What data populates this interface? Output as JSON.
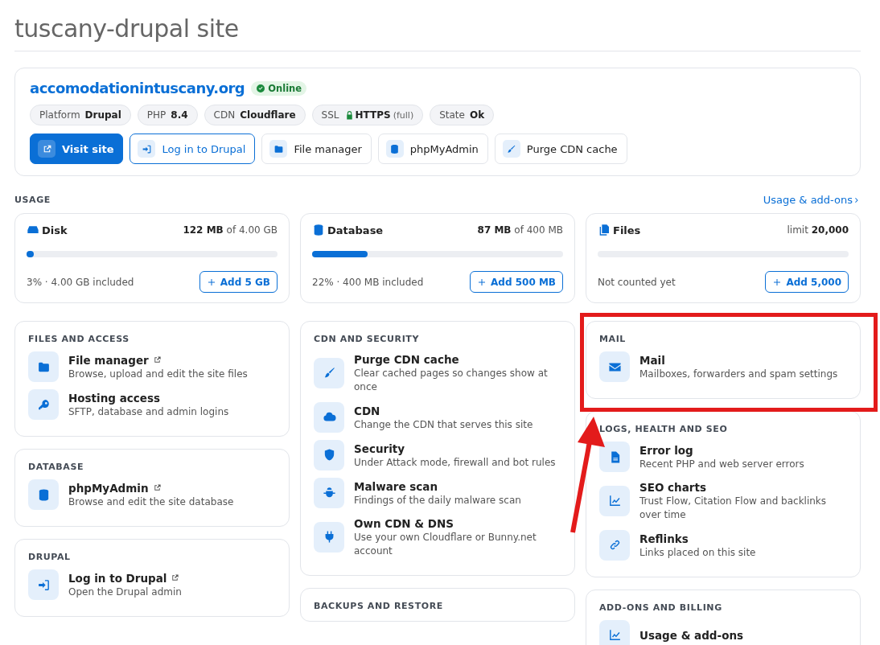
{
  "page_title": "tuscany-drupal site",
  "site": {
    "domain": "accomodationintuscany.org",
    "status": "Online",
    "facts": [
      {
        "label": "Platform",
        "value": "Drupal",
        "kind": "plain"
      },
      {
        "label": "PHP",
        "value": "8.4",
        "kind": "plain"
      },
      {
        "label": "CDN",
        "value": "Cloudflare",
        "kind": "plain"
      },
      {
        "label": "SSL",
        "value": "HTTPS",
        "note": "(full)",
        "kind": "secure"
      },
      {
        "label": "State",
        "value": "Ok",
        "kind": "plain"
      }
    ],
    "actions": [
      {
        "label": "Visit site",
        "kind": "primary"
      },
      {
        "label": "Log in to Drupal",
        "kind": "outline"
      },
      {
        "label": "File manager",
        "kind": "plain"
      },
      {
        "label": "phpMyAdmin",
        "kind": "plain"
      },
      {
        "label": "Purge CDN cache",
        "kind": "plain"
      }
    ]
  },
  "usage": {
    "heading": "USAGE",
    "link": "Usage & add-ons",
    "meters": [
      {
        "title": "Disk",
        "reading": "**122 MB** of 4.00 GB",
        "level": 0.03,
        "note": "3% · 4.00 GB included",
        "button": "Add 5 GB"
      },
      {
        "title": "Database",
        "reading": "**87 MB** of 400 MB",
        "level": 0.22,
        "note": "22% · 400 MB included",
        "button": "Add 500 MB"
      },
      {
        "title": "Files",
        "reading": "limit **20,000**",
        "note": "Not counted yet",
        "button": "Add 5,000"
      }
    ]
  },
  "columns": [
    [
      {
        "heading": "FILES AND ACCESS",
        "items": [
          {
            "title": "File manager",
            "desc": "Browse, upload and edit the site files",
            "external": true
          },
          {
            "title": "Hosting access",
            "desc": "SFTP, database and admin logins",
            "external": false
          }
        ]
      },
      {
        "heading": "DATABASE",
        "items": [
          {
            "title": "phpMyAdmin",
            "desc": "Browse and edit the site database",
            "external": true
          }
        ]
      },
      {
        "heading": "DRUPAL",
        "items": [
          {
            "title": "Log in to Drupal",
            "desc": "Open the Drupal admin",
            "external": true
          }
        ]
      }
    ],
    [
      {
        "heading": "CDN AND SECURITY",
        "items": [
          {
            "title": "Purge CDN cache",
            "desc": "Clear cached pages so changes show at once",
            "external": false
          },
          {
            "title": "CDN",
            "desc": "Change the CDN that serves this site",
            "external": false
          },
          {
            "title": "Security",
            "desc": "Under Attack mode, firewall and bot rules",
            "external": false
          },
          {
            "title": "Malware scan",
            "desc": "Findings of the daily malware scan",
            "external": false
          },
          {
            "title": "Own CDN & DNS",
            "desc": "Use your own Cloudflare or Bunny.net account",
            "external": false
          }
        ]
      },
      {
        "heading": "BACKUPS AND RESTORE"
      }
    ],
    [
      {
        "heading": "MAIL",
        "items": [
          {
            "title": "Mail",
            "desc": "Mailboxes, forwarders and spam settings",
            "external": false
          }
        ]
      },
      {
        "heading": "LOGS, HEALTH AND SEO",
        "items": [
          {
            "title": "Error log",
            "desc": "Recent PHP and web server errors",
            "external": false
          },
          {
            "title": "SEO charts",
            "desc": "Trust Flow, Citation Flow and backlinks over time",
            "external": false
          },
          {
            "title": "Reflinks",
            "desc": "Links placed on this site",
            "external": false
          }
        ]
      },
      {
        "heading": "ADD-ONS AND BILLING",
        "items": [
          {
            "title": "Usage & add-ons",
            "external": false
          }
        ]
      }
    ]
  ]
}
